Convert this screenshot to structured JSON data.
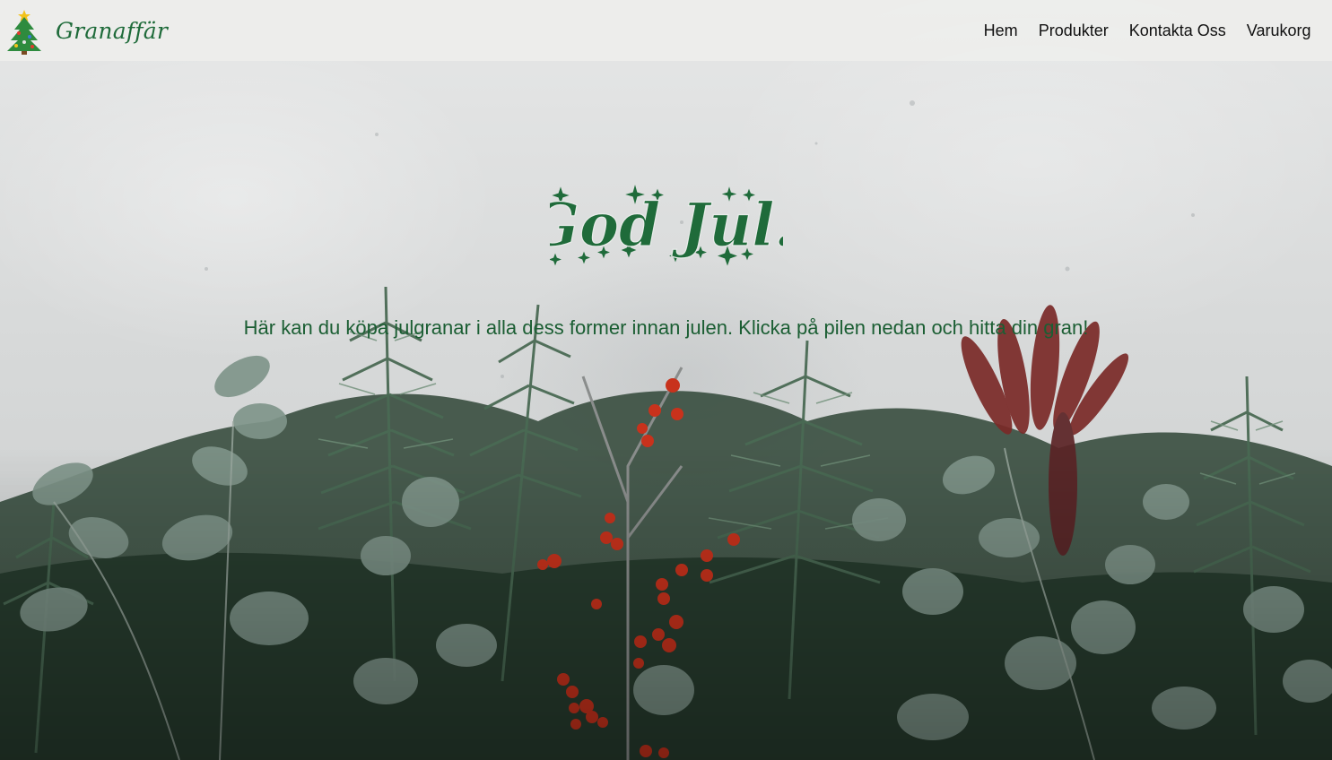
{
  "navbar": {
    "brand_name": "Granaffär",
    "logo_icon": "christmas-tree-icon",
    "links": [
      "Hem",
      "Produkter",
      "Kontakta Oss",
      "Varukorg"
    ]
  },
  "hero": {
    "headline": "God Jul!",
    "subtitle": "Här kan du köpa julgranar i alla dess former innan julen. Klicka på pilen nedan och hitta din gran!",
    "background": "concrete wall with fir branches, eucalyptus and red berries"
  },
  "colors": {
    "brand_green": "#1f6b3a",
    "text_green": "#1b5e33",
    "navbar_bg": "#eeeeec",
    "berry_red": "#c8321c"
  }
}
